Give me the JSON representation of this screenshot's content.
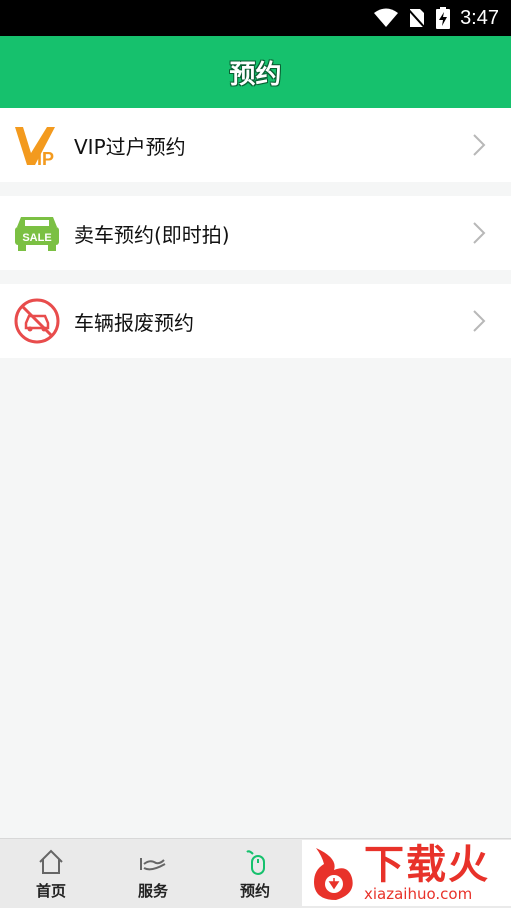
{
  "status_bar": {
    "time": "3:47"
  },
  "title_bar": {
    "title": "预约"
  },
  "list": [
    {
      "label": "VIP过户预约",
      "icon": "vip-icon"
    },
    {
      "label": "卖车预约(即时拍)",
      "icon": "sale-car-icon"
    },
    {
      "label": "车辆报废预约",
      "icon": "car-scrap-icon"
    }
  ],
  "tabbar": [
    {
      "label": "首页",
      "icon": "home-icon"
    },
    {
      "label": "服务",
      "icon": "hand-service-icon"
    },
    {
      "label": "预约",
      "icon": "mouse-icon",
      "active": true
    }
  ],
  "watermark": {
    "cn": "下载火",
    "en": "xiazaihuo.com"
  },
  "colors": {
    "accent": "#16c16d",
    "vip": "#f39a1e",
    "sale": "#7bc043",
    "scrap": "#e84c4c"
  }
}
